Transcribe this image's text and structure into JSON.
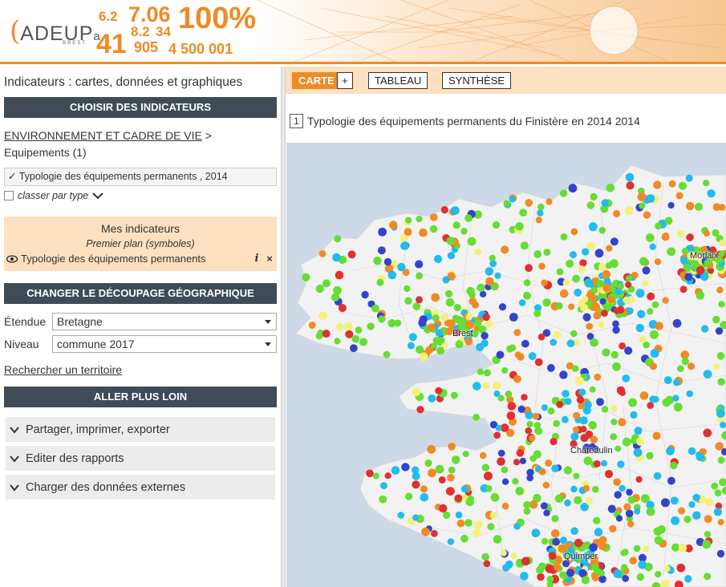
{
  "header": {
    "logo_text": "ADEUP",
    "logo_suffix": "a",
    "logo_city": "BREST",
    "numbers": [
      {
        "text": "6.2",
        "pos": 0
      },
      {
        "text": "7.06",
        "pos": 1
      },
      {
        "text": "100%",
        "pos": 2
      },
      {
        "text": "8.2",
        "pos": 3
      },
      {
        "text": "34",
        "pos": 4
      },
      {
        "text": "41",
        "pos": 5
      },
      {
        "text": "905",
        "pos": 6
      },
      {
        "text": "4 500 001",
        "pos": 7
      }
    ]
  },
  "left": {
    "page_title": "Indicateurs : cartes, données et graphiques",
    "section_indicators": "CHOISIR DES INDICATEURS",
    "breadcrumb": {
      "link": "ENVIRONNEMENT ET CADRE DE VIE",
      "separator": ">",
      "current": "Equipements (1)"
    },
    "selected_indicator": "✓ Typologie des équipements permanents , 2014",
    "classer_label": "classer par type",
    "mes_indicateurs": {
      "title": "Mes indicateurs",
      "subtitle": "Premier plan (symboles)",
      "item": "Typologie des équipements permanents"
    },
    "section_geo": "CHANGER LE DÉCOUPAGE GÉOGRAPHIQUE",
    "etendue_label": "Étendue",
    "etendue_value": "Bretagne",
    "niveau_label": "Niveau",
    "niveau_value": "commune 2017",
    "search_link": "Rechercher un territoire",
    "section_more": "ALLER PLUS LOIN",
    "accordion": [
      "Partager, imprimer, exporter",
      "Editer des rapports",
      "Charger des données externes"
    ]
  },
  "tabs": {
    "carte": "CARTE",
    "plus": "+",
    "tableau": "TABLEAU",
    "synthese": "SYNTHÈSE"
  },
  "map": {
    "index": "1",
    "title": "Typologie des équipements permanents du Finistère en 2014 2014",
    "cities": [
      "Morlaix",
      "Brest",
      "Châteaulin",
      "Quimper"
    ],
    "colors": {
      "sea": "#cdd9e6",
      "land": "#f2f2f2",
      "green": "#66dd33",
      "cyan": "#22bbee",
      "orange": "#f08a24",
      "yellow": "#f5f07a",
      "blue": "#3344cc",
      "red": "#e03030"
    }
  }
}
